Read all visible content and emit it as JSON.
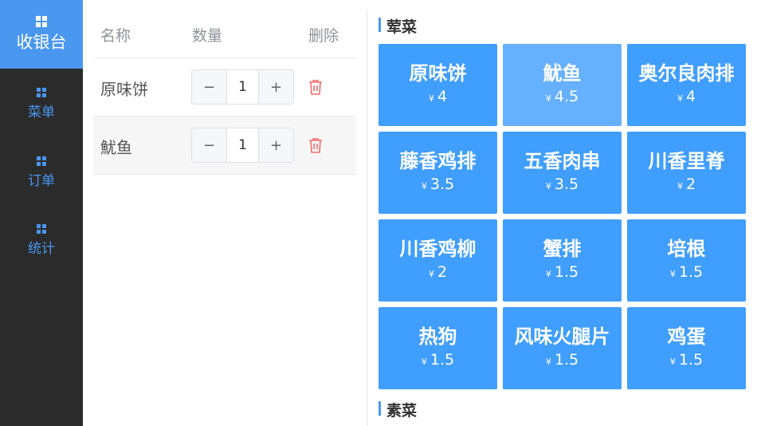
{
  "sidebar": {
    "items": [
      {
        "label": "收银台",
        "active": true
      },
      {
        "label": "菜单",
        "active": false
      },
      {
        "label": "订单",
        "active": false
      },
      {
        "label": "统计",
        "active": false
      }
    ]
  },
  "order": {
    "columns": [
      "名称",
      "数量",
      "删除"
    ],
    "rows": [
      {
        "name": "原味饼",
        "qty": "1"
      },
      {
        "name": "魷鱼",
        "qty": "1"
      }
    ],
    "minus_symbol": "−",
    "plus_symbol": "+"
  },
  "menu": {
    "currency": "¥",
    "sections": [
      {
        "title": "荤菜",
        "items": [
          {
            "name": "原味饼",
            "price": "4"
          },
          {
            "name": "魷鱼",
            "price": "4.5"
          },
          {
            "name": "奥尔良肉排",
            "price": "4"
          },
          {
            "name": "藤香鸡排",
            "price": "3.5"
          },
          {
            "name": "五香肉串",
            "price": "3.5"
          },
          {
            "name": "川香里脊",
            "price": "2"
          },
          {
            "name": "川香鸡柳",
            "price": "2"
          },
          {
            "name": "蟹排",
            "price": "1.5"
          },
          {
            "name": "培根",
            "price": "1.5"
          },
          {
            "name": "热狗",
            "price": "1.5"
          },
          {
            "name": "风味火腿片",
            "price": "1.5"
          },
          {
            "name": "鸡蛋",
            "price": "1.5"
          }
        ]
      },
      {
        "title": "素菜",
        "items": []
      }
    ]
  },
  "colors": {
    "accent": "#409eff",
    "accent_light": "#66b1ff",
    "sidebar_bg": "#2b2b2b",
    "delete": "#f56c6c"
  }
}
